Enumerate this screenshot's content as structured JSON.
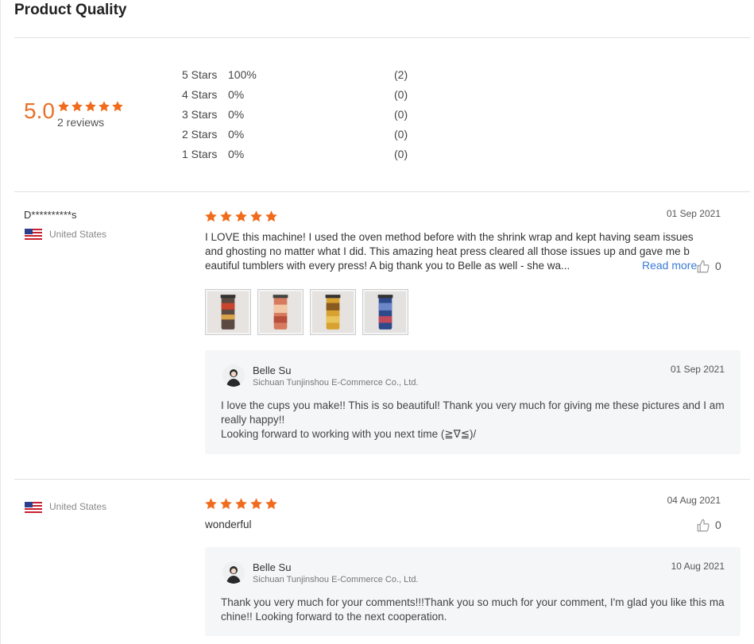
{
  "page": {
    "title": "Product Quality"
  },
  "summary": {
    "score": "5.0",
    "reviews": "2 reviews",
    "stars_value": 5,
    "breakdown": [
      {
        "label": "5 Stars",
        "percent": "100%",
        "count": "(2)"
      },
      {
        "label": "4 Stars",
        "percent": "0%",
        "count": "(0)"
      },
      {
        "label": "3 Stars",
        "percent": "0%",
        "count": "(0)"
      },
      {
        "label": "2 Stars",
        "percent": "0%",
        "count": "(0)"
      },
      {
        "label": "1 Stars",
        "percent": "0%",
        "count": "(0)"
      }
    ]
  },
  "colors": {
    "star": "#f06c1c",
    "accent": "#e8702a",
    "link": "#3a7bd5"
  },
  "reviews": [
    {
      "name": "D**********s",
      "country": "United States",
      "rating": 5,
      "date": "01 Sep 2021",
      "text": "I LOVE this machine!  I used the oven method before with the shrink wrap and kept having seam issues and ghosting no matter what I did.  This amazing heat press cleared all those issues up and gave me beautiful tumblers with every press!  A big thank you to Belle as well - she wa...",
      "read_more": "Read more",
      "likes": "0",
      "photos": [
        "tumbler-photo",
        "tumbler-photo",
        "tumbler-photo",
        "tumbler-photo"
      ],
      "reply": {
        "seller": "Belle Su",
        "company": "Sichuan Tunjinshou E-Commerce Co., Ltd.",
        "date": "01 Sep 2021",
        "text_line1": " I love the cups you make!! This is so beautiful! Thank you very much for giving me these pictures and I am really happy!!",
        "text_line2": "Looking forward to working with you next time (≧∇≦)/"
      }
    },
    {
      "name": "",
      "country": "United States",
      "rating": 5,
      "date": "04 Aug 2021",
      "text": "wonderful",
      "likes": "0",
      "reply": {
        "seller": "Belle Su",
        "company": "Sichuan Tunjinshou E-Commerce Co., Ltd.",
        "date": "10 Aug 2021",
        "text_line1": "Thank you very much for your comments!!!Thank you so much for your comment, I'm glad you like this machine!! Looking forward to the next cooperation."
      }
    }
  ]
}
